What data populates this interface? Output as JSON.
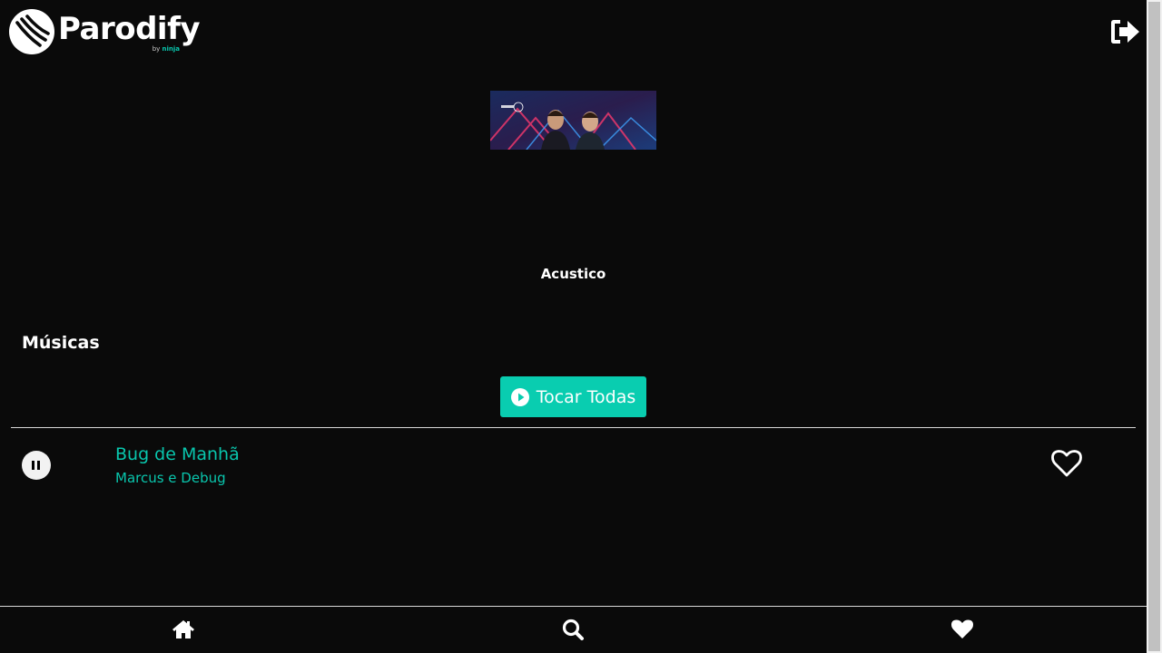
{
  "app": {
    "logo_text": "Parodify",
    "logo_by": "by",
    "logo_brand": "ninja"
  },
  "album": {
    "title": "Acustico",
    "cover_alt": "Album cover with two singers on stage"
  },
  "tracks_section": {
    "title": "Músicas",
    "play_all_label": "Tocar Todas"
  },
  "tracks": [
    {
      "title": "Bug de Manhã",
      "artist": "Marcus e Debug",
      "state": "playing"
    }
  ],
  "nav": {
    "items": [
      {
        "icon": "home-icon"
      },
      {
        "icon": "search-icon"
      },
      {
        "icon": "heart-icon"
      }
    ]
  },
  "colors": {
    "background": "#0a0a0a",
    "accent": "#09cdb0",
    "text": "#ffffff"
  }
}
